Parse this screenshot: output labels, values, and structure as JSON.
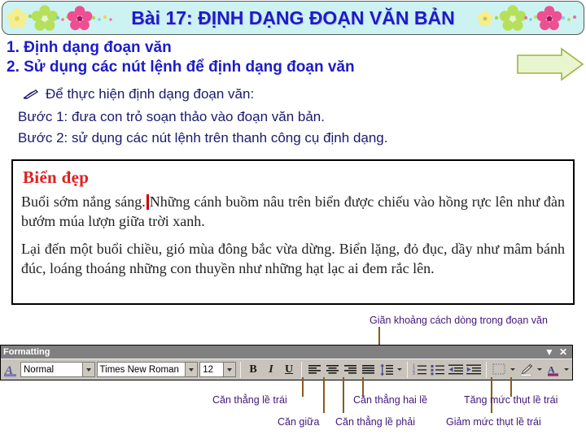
{
  "slide": {
    "title": "Bài 17: ĐỊNH DẠNG ĐOẠN VĂN BẢN",
    "heading_1": "1. Định dạng đoạn văn",
    "heading_2": "2. Sử dụng các nút lệnh để định dạng đoạn văn",
    "bullet_line": "Để thực hiện định dạng đoạn văn:",
    "step_1": "Bước 1: đưa con trỏ soạn thảo vào đoạn văn bản.",
    "step_2": "Bước 2: sử dụng các nút lệnh trên thanh công cụ định dạng."
  },
  "document_preview": {
    "title": "Biển đẹp",
    "paragraph_1_before_caret": "Buổi sớm nắng sáng.",
    "paragraph_1_after_caret": "Những cánh buồm nâu trên biển được chiếu vào hồng rực lên như đàn bướm múa lượn giữa trời xanh.",
    "paragraph_2": "Lại đến một buổi chiều, gió mùa đông bắc vừa dừng. Biển lặng, đỏ đục, dầy như mâm bánh đúc, loáng thoáng những con thuyền như những hạt lạc ai đem rắc lên."
  },
  "toolbar": {
    "window_title": "Formatting",
    "minimize_label": "▼",
    "close_label": "✕",
    "style_value": "Normal",
    "font_value": "Times New Roman",
    "size_value": "12",
    "bold_label": "B",
    "italic_label": "I",
    "underline_label": "U"
  },
  "annotations": {
    "line_spacing": "Giãn khoảng cách dòng trong đoạn văn",
    "align_left": "Căn thẳng lề trái",
    "align_center": "Căn giữa",
    "align_right": "Căn thẳng lề phải",
    "align_justify": "Căn thẳng hai lề",
    "indent_increase": "Tăng mức thụt lề trái",
    "indent_decrease": "Giảm mức thụt lề trái"
  },
  "colors": {
    "title_text": "#1c1cc8",
    "title_background": "#cdf2f2",
    "doc_title": "#e02020",
    "annotation_text": "#40187a",
    "connector": "#8a5a1e",
    "arrow_fill": "#e8f5ce",
    "arrow_border": "#9bb53d",
    "toolbar_face": "#c8c4bc",
    "toolbar_titlebar": "#808080"
  }
}
